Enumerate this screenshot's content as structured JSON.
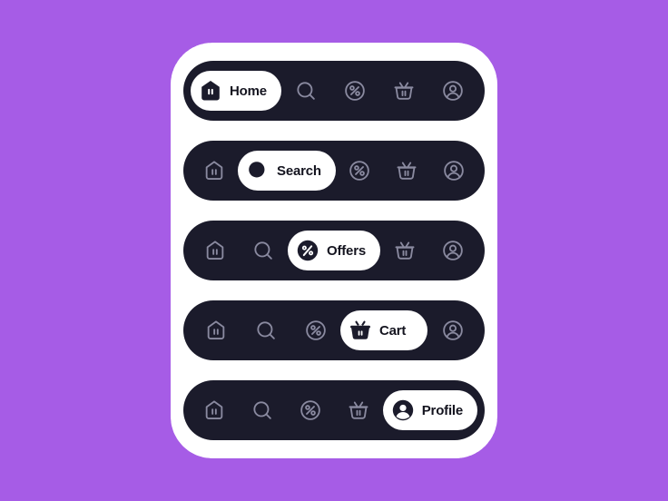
{
  "canvas": {
    "background_color": "#a65ce6",
    "card_color": "#ffffff",
    "bar_color": "#1b1b2b",
    "inactive_icon_color": "#8a8aa0",
    "active_text_color": "#14141f"
  },
  "items": [
    {
      "key": "home",
      "label": "Home",
      "icon": "home-icon"
    },
    {
      "key": "search",
      "label": "Search",
      "icon": "search-icon"
    },
    {
      "key": "offers",
      "label": "Offers",
      "icon": "percent-icon"
    },
    {
      "key": "cart",
      "label": "Cart",
      "icon": "basket-icon"
    },
    {
      "key": "profile",
      "label": "Profile",
      "icon": "person-icon"
    }
  ],
  "bars": [
    {
      "name": "navbar-home-active",
      "active_index": 0,
      "active_label": "Home"
    },
    {
      "name": "navbar-search-active",
      "active_index": 1,
      "active_label": "Search"
    },
    {
      "name": "navbar-offers-active",
      "active_index": 2,
      "active_label": "Offers"
    },
    {
      "name": "navbar-cart-active",
      "active_index": 3,
      "active_label": "Cart"
    },
    {
      "name": "navbar-profile-active",
      "active_index": 4,
      "active_label": "Profile"
    }
  ]
}
